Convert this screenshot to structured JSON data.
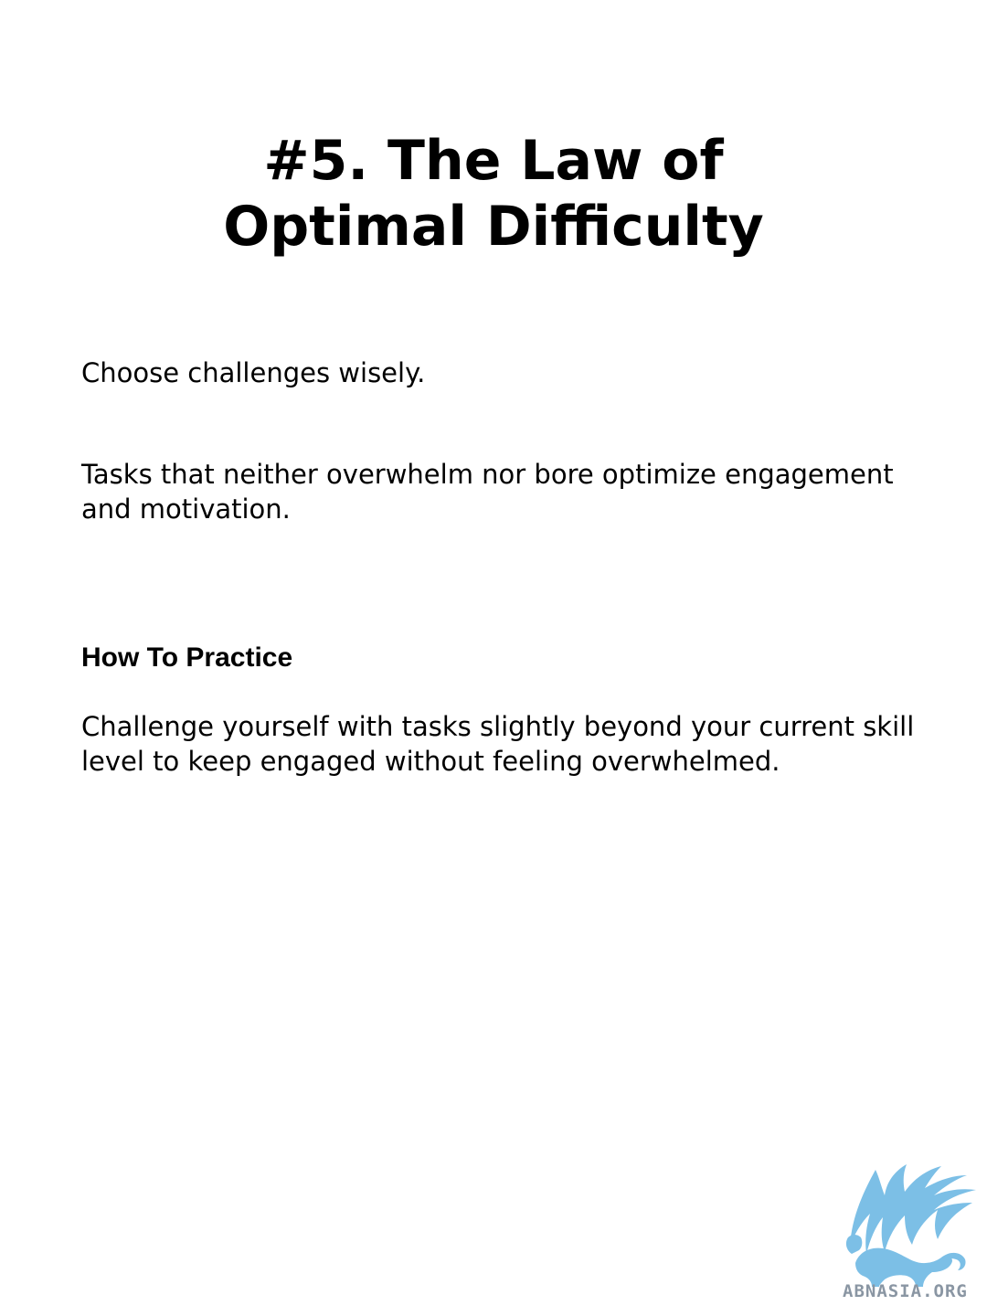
{
  "title": {
    "line1": "#5. The Law of",
    "line2": "Optimal Difficulty"
  },
  "intro": "Choose challenges wisely.",
  "description": "Tasks that neither overwhelm nor bore optimize engagement and motivation.",
  "practice": {
    "heading": "How To Practice",
    "text": "Challenge yourself with tasks slightly beyond your current skill level to keep engaged without feeling overwhelmed."
  },
  "logo": {
    "icon": "griffin-logo-icon",
    "text": "ABNASIA.ORG",
    "color": "#7cbfe6"
  }
}
